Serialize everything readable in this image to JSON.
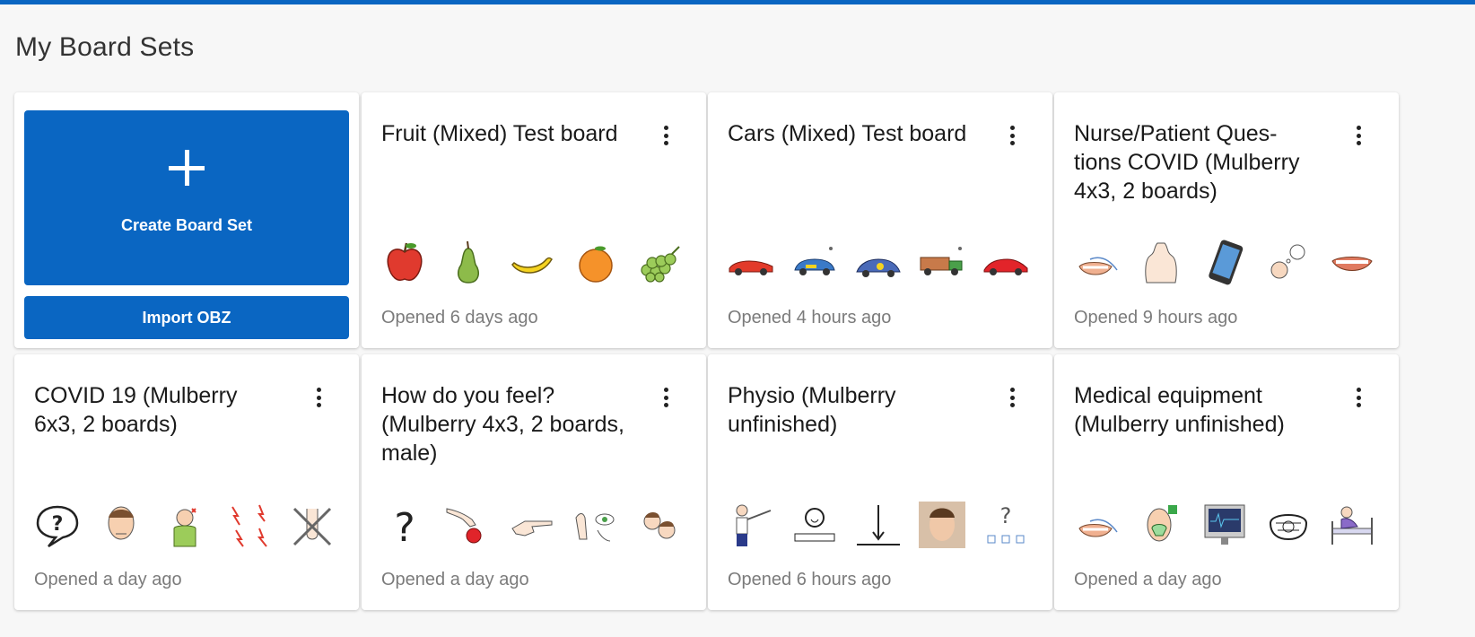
{
  "page": {
    "title": "My Board Sets",
    "accent": "#0a66c2"
  },
  "create": {
    "label": "Create Board Set",
    "import_label": "Import OBZ"
  },
  "boards": [
    {
      "title": "Fruit (Mixed) Test board",
      "opened": "Opened 6 days ago",
      "icons": [
        "apple-icon",
        "pear-icon",
        "banana-icon",
        "orange-icon",
        "grapes-icon"
      ]
    },
    {
      "title": "Cars (Mixed) Test board",
      "opened": "Opened 4 hours ago",
      "icons": [
        "red-car-icon",
        "rally-car-icon",
        "race-car-icon",
        "truck-icon",
        "sports-car-icon"
      ]
    },
    {
      "title": "Nurse/Patient Ques-\ntions COVID (Mulberry\n4x3, 2 boards)",
      "opened": "Opened 9 hours ago",
      "icons": [
        "swab-mouth-icon",
        "body-icon",
        "phone-icon",
        "person-thinking-icon",
        "mouth-icon"
      ]
    },
    {
      "title": "COVID 19 (Mulberry\n6x3, 2 boards)",
      "opened": "Opened a day ago",
      "icons": [
        "question-bubble-icon",
        "sick-face-icon",
        "headache-icon",
        "pain-icon",
        "no-smell-icon"
      ]
    },
    {
      "title": "How do you feel?\n(Mulberry 4x3, 2 boards,\nmale)",
      "opened": "Opened a day ago",
      "icons": [
        "question-mark-icon",
        "pick-cherry-icon",
        "point-hand-icon",
        "see-hear-icon",
        "people-icon"
      ]
    },
    {
      "title": "Physio (Mulberry\nunfinished)",
      "opened": "Opened 6 hours ago",
      "icons": [
        "stretch-icon",
        "person-at-desk-icon",
        "down-arrow-icon",
        "face-photo-icon",
        "question-boxes-icon"
      ]
    },
    {
      "title": "Medical equipment\n(Mulberry unfinished)",
      "opened": "Opened a day ago",
      "icons": [
        "swab-mouth-icon",
        "oxygen-mask-icon",
        "monitor-icon",
        "face-mask-icon",
        "hospital-bed-icon"
      ]
    }
  ]
}
